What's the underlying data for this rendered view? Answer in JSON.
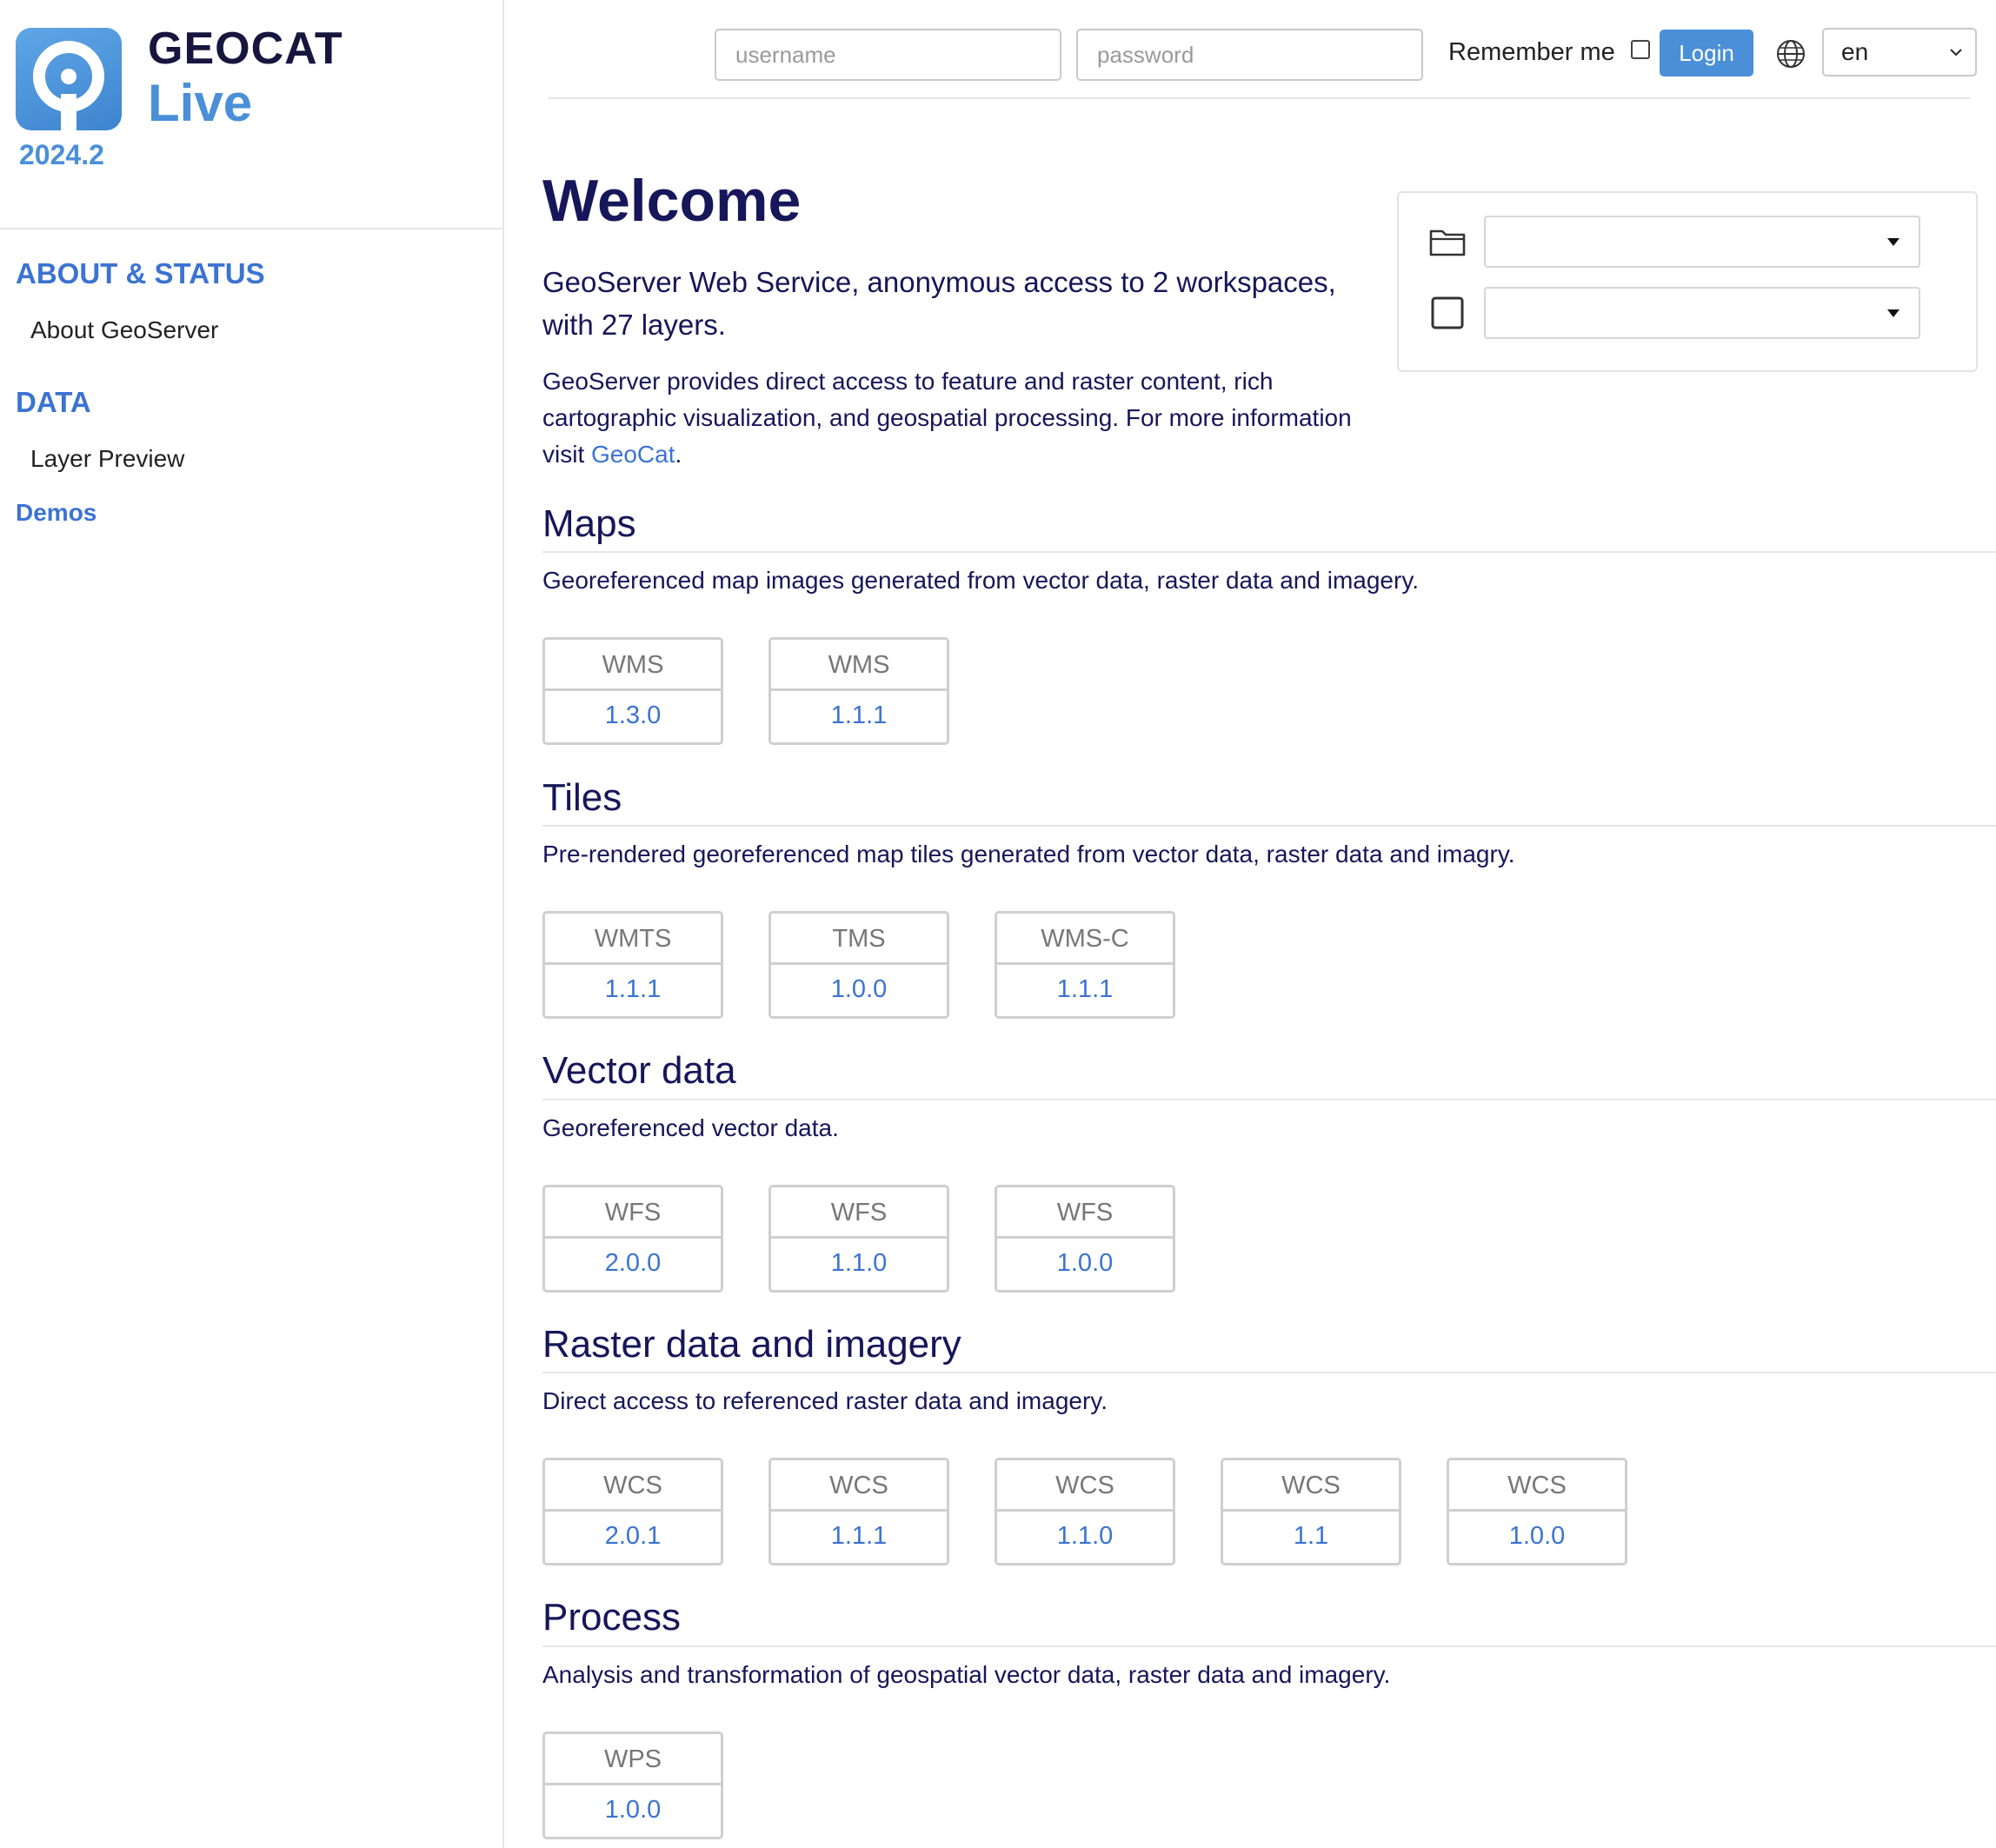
{
  "brand": {
    "name": "GEOCAT",
    "product": "Live",
    "version": "2024.2",
    "icon": "geocat-logo-icon"
  },
  "sidebar": {
    "sections": [
      {
        "heading": "ABOUT & STATUS",
        "items": [
          "About GeoServer"
        ]
      },
      {
        "heading": "DATA",
        "items": [
          "Layer Preview"
        ]
      }
    ],
    "links": [
      "Demos"
    ]
  },
  "header": {
    "username_placeholder": "username",
    "password_placeholder": "password",
    "remember_label": "Remember me",
    "login_label": "Login",
    "language": "en",
    "globe_icon": "globe-icon"
  },
  "welcome": {
    "title": "Welcome",
    "lead": "GeoServer Web Service, anonymous access to 2 workspaces, with 27 layers.",
    "desc_prefix": "GeoServer provides direct access to feature and raster content, rich cartographic visualization, and geospatial processing. For more information visit ",
    "desc_link": "GeoCat",
    "desc_suffix": "."
  },
  "filters": {
    "workspace_icon": "folder-icon",
    "layer_icon": "square-layer-icon",
    "workspace_value": "",
    "layer_value": ""
  },
  "sections": [
    {
      "title": "Maps",
      "description": "Georeferenced map images generated from vector data, raster data and imagery.",
      "services": [
        {
          "name": "WMS",
          "version": "1.3.0"
        },
        {
          "name": "WMS",
          "version": "1.1.1"
        }
      ]
    },
    {
      "title": "Tiles",
      "description": "Pre-rendered georeferenced map tiles generated from vector data, raster data and imagry.",
      "services": [
        {
          "name": "WMTS",
          "version": "1.1.1"
        },
        {
          "name": "TMS",
          "version": "1.0.0"
        },
        {
          "name": "WMS-C",
          "version": "1.1.1"
        }
      ]
    },
    {
      "title": "Vector data",
      "description": "Georeferenced vector data.",
      "services": [
        {
          "name": "WFS",
          "version": "2.0.0"
        },
        {
          "name": "WFS",
          "version": "1.1.0"
        },
        {
          "name": "WFS",
          "version": "1.0.0"
        }
      ]
    },
    {
      "title": "Raster data and imagery",
      "description": "Direct access to referenced raster data and imagery.",
      "services": [
        {
          "name": "WCS",
          "version": "2.0.1"
        },
        {
          "name": "WCS",
          "version": "1.1.1"
        },
        {
          "name": "WCS",
          "version": "1.1.0"
        },
        {
          "name": "WCS",
          "version": "1.1"
        },
        {
          "name": "WCS",
          "version": "1.0.0"
        }
      ]
    },
    {
      "title": "Process",
      "description": "Analysis and transformation of geospatial vector data, raster data and imagery.",
      "services": [
        {
          "name": "WPS",
          "version": "1.0.0"
        }
      ]
    }
  ],
  "colors": {
    "accent": "#4a8fd8",
    "link": "#3b73d1",
    "heading": "#16165a"
  }
}
